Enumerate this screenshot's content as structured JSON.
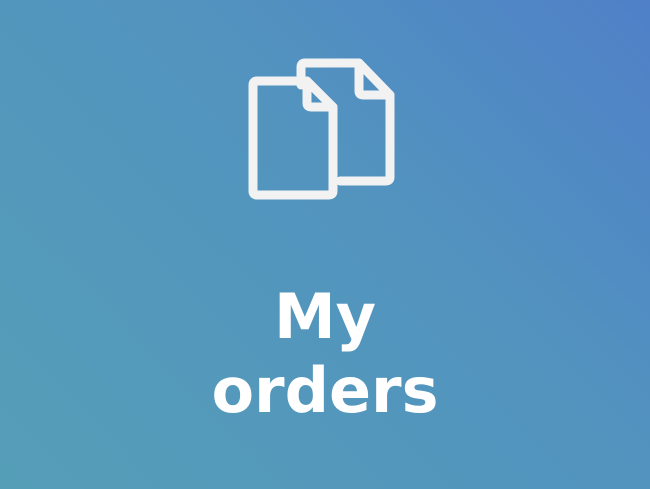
{
  "tile": {
    "label_line1": "My",
    "label_line2": "orders",
    "icon": "documents-icon",
    "colors": {
      "background_start": "#4f80c8",
      "background_end": "#559eb7",
      "foreground": "#f2f2f2"
    }
  }
}
